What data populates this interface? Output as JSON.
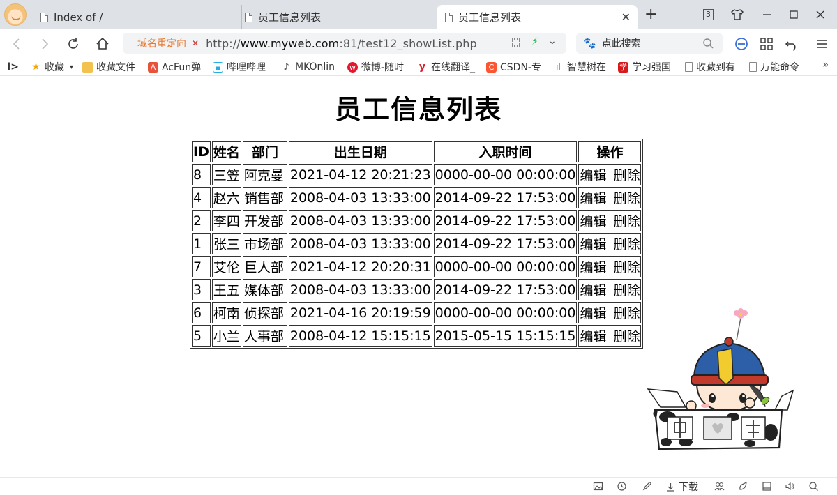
{
  "tabs": [
    {
      "label": "Index of /"
    },
    {
      "label": "员工信息列表"
    },
    {
      "label": "员工信息列表",
      "active": true
    }
  ],
  "tab_count": "3",
  "address": {
    "redirect_label": "域名重定向",
    "url_prefix": "http://",
    "url_host": "www.myweb.com",
    "url_rest": ":81/test12_showList.php"
  },
  "search": {
    "placeholder": "点此搜索"
  },
  "bookmarks": [
    {
      "label": "收藏",
      "icon": "star-icon"
    },
    {
      "label": "收藏文件",
      "icon": "folder-icon"
    },
    {
      "label": "AcFun弹",
      "icon": "acfun-icon"
    },
    {
      "label": "哔哩哔哩",
      "icon": "bilibili-icon"
    },
    {
      "label": "MKOnlin",
      "icon": "music-icon"
    },
    {
      "label": "微博-随时",
      "icon": "weibo-icon"
    },
    {
      "label": "在线翻译_",
      "icon": "youdao-icon"
    },
    {
      "label": "CSDN-专",
      "icon": "csdn-icon"
    },
    {
      "label": "智慧树在",
      "icon": "zhihuishu-icon"
    },
    {
      "label": "学习强国",
      "icon": "xuexi-icon"
    },
    {
      "label": "收藏到有",
      "icon": "page-icon"
    },
    {
      "label": "万能命令",
      "icon": "page-icon"
    }
  ],
  "page": {
    "title": "员工信息列表",
    "columns": [
      "ID",
      "姓名",
      "部门",
      "出生日期",
      "入职时间",
      "操作"
    ],
    "rows": [
      {
        "id": "8",
        "name": "三笠",
        "dept": "阿克曼",
        "birth": "2021-04-12 20:21:23",
        "hired": "0000-00-00 00:00:00"
      },
      {
        "id": "4",
        "name": "赵六",
        "dept": "销售部",
        "birth": "2008-04-03 13:33:00",
        "hired": "2014-09-22 17:53:00"
      },
      {
        "id": "2",
        "name": "李四",
        "dept": "开发部",
        "birth": "2008-04-03 13:33:00",
        "hired": "2014-09-22 17:53:00"
      },
      {
        "id": "1",
        "name": "张三",
        "dept": "市场部",
        "birth": "2008-04-03 13:33:00",
        "hired": "2014-09-22 17:53:00"
      },
      {
        "id": "7",
        "name": "艾伦",
        "dept": "巨人部",
        "birth": "2021-04-12 20:20:31",
        "hired": "0000-00-00 00:00:00"
      },
      {
        "id": "3",
        "name": "王五",
        "dept": "媒体部",
        "birth": "2008-04-03 13:33:00",
        "hired": "2014-09-22 17:53:00"
      },
      {
        "id": "6",
        "name": "柯南",
        "dept": "侦探部",
        "birth": "2021-04-16 20:19:59",
        "hired": "0000-00-00 00:00:00"
      },
      {
        "id": "5",
        "name": "小兰",
        "dept": "人事部",
        "birth": "2008-04-12 15:15:15",
        "hired": "2015-05-15 15:15:15"
      }
    ],
    "edit_label": "编辑",
    "delete_label": "删除"
  },
  "statusbar": {
    "download_label": "下载"
  },
  "colors": {
    "redirect": "#e8772e",
    "tabbar": "#dee1e6",
    "accent": "#3b6fd8"
  }
}
